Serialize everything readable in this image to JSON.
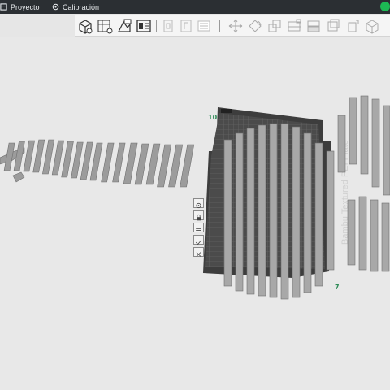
{
  "topbar": {
    "tabs": [
      {
        "label": "Proyecto",
        "icon": "project-icon"
      },
      {
        "label": "Calibración",
        "icon": "calibration-icon"
      }
    ],
    "status_color": "#1db954"
  },
  "toolbar": {
    "buttons": [
      "add-cube-icon",
      "grid-icon",
      "import-icon",
      "layout-icon",
      "orient-icon",
      "arrange-icon",
      "split-icon",
      "move-icon",
      "rotate-icon",
      "scale-icon",
      "cut-icon",
      "support-icon",
      "seam-icon",
      "brush-icon",
      "measure-icon"
    ]
  },
  "viewport": {
    "plate": {
      "number_top": "10",
      "number_bottom": "7",
      "bed_text": "Bambu Textured PEI Plate"
    },
    "side_tools": [
      "settings-icon",
      "lock-icon",
      "layers-icon",
      "check-icon",
      "close-icon"
    ],
    "colors": {
      "background": "#e8e8e8",
      "model": "#9a9a9a",
      "plate": "#4a4a4a",
      "plate_grid": "#707070",
      "accent": "#2e8b57"
    }
  }
}
